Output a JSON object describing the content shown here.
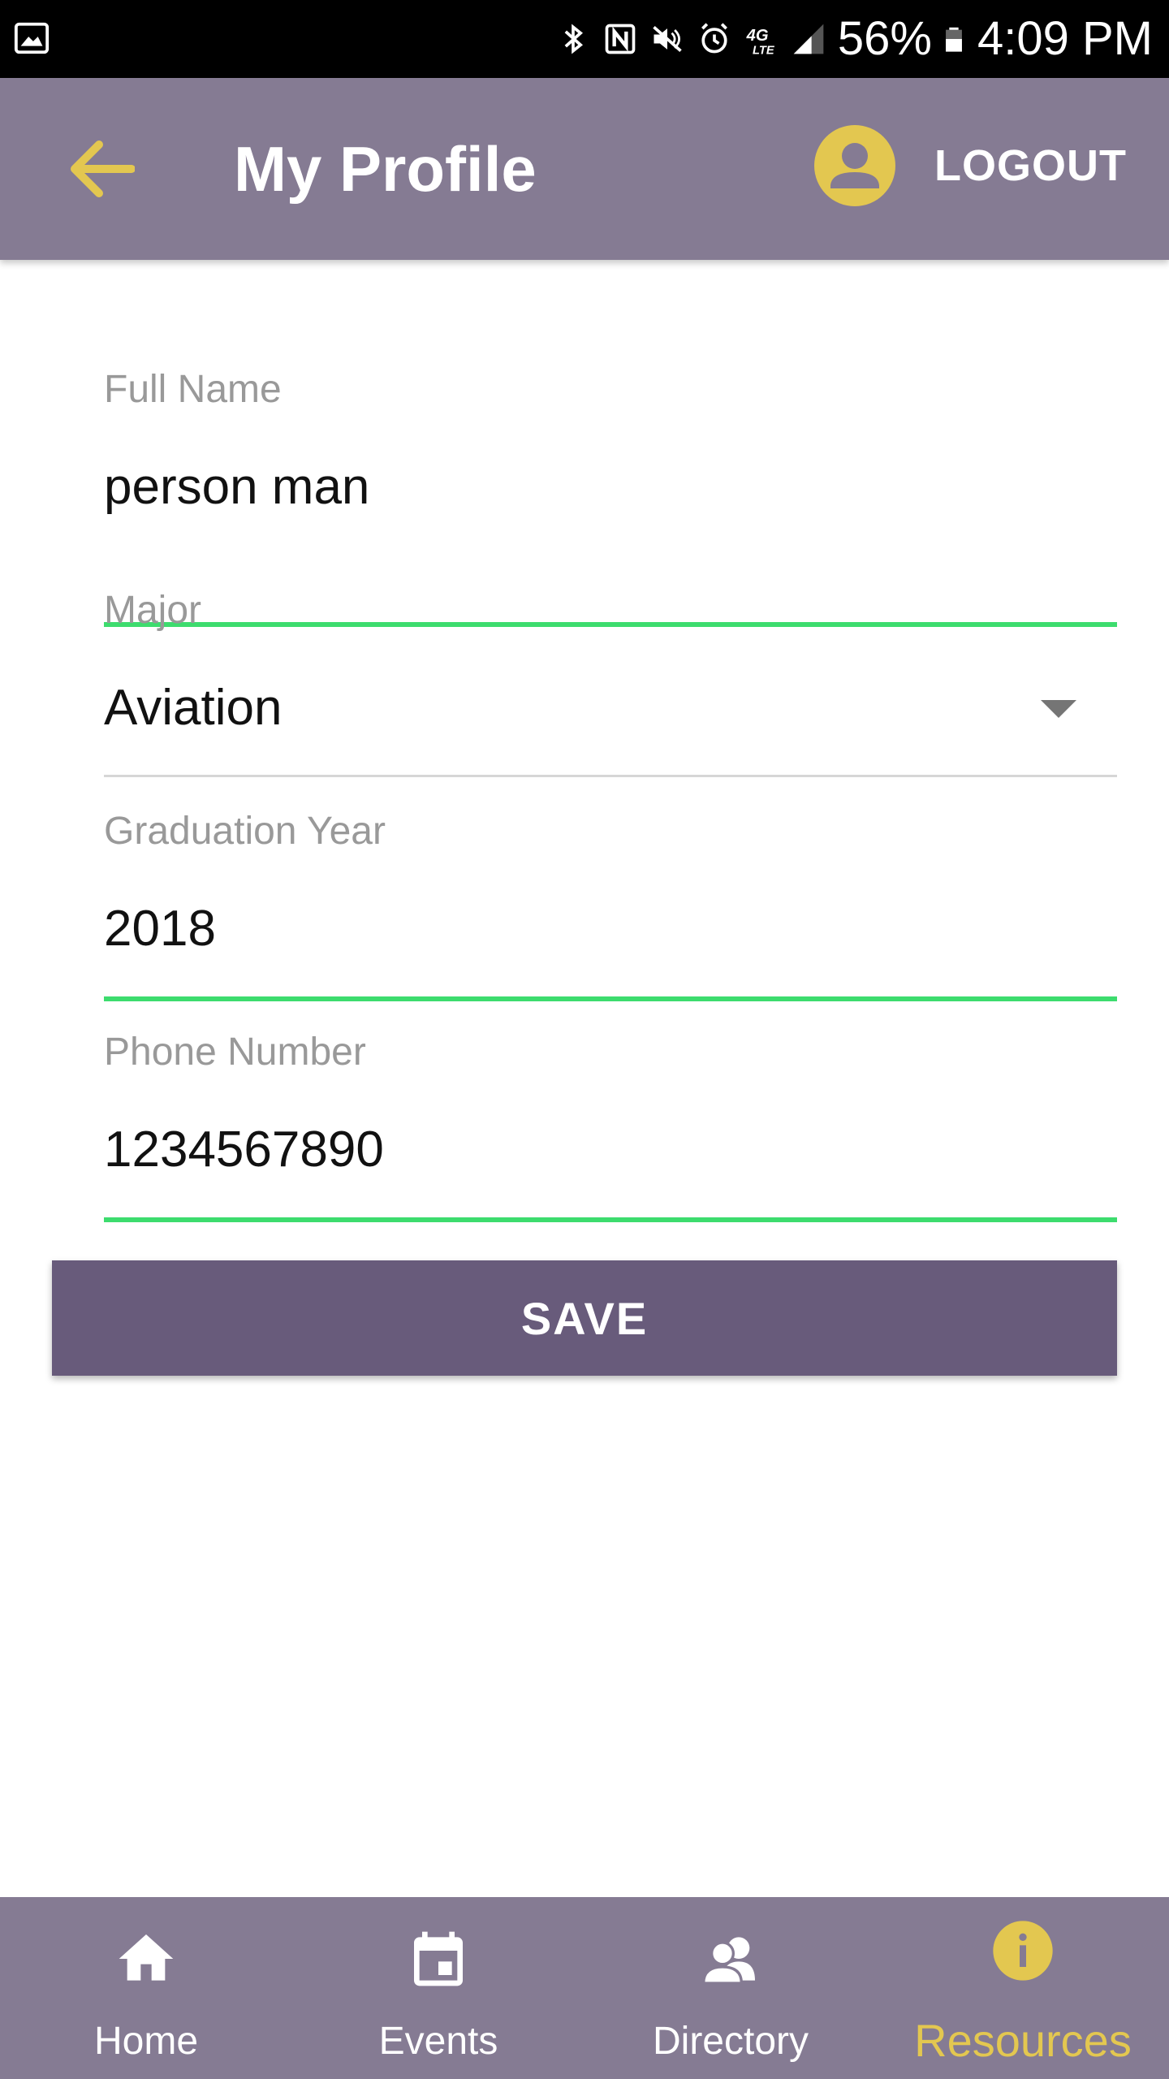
{
  "status_bar": {
    "battery": "56%",
    "time": "4:09 PM",
    "icons": [
      "gallery-icon",
      "bluetooth-icon",
      "nfc-icon",
      "mute-icon",
      "alarm-icon",
      "4g-lte-icon",
      "signal-icon",
      "battery-icon"
    ]
  },
  "header": {
    "title": "My Profile",
    "logout_label": "LOGOUT",
    "back_icon": "arrow-left-icon",
    "avatar_icon": "account-circle-icon",
    "background_color": "#857b93",
    "accent_color": "#e3c750"
  },
  "form": {
    "full_name": {
      "label": "Full Name",
      "value": "person man"
    },
    "major": {
      "label": "Major",
      "value": "Aviation"
    },
    "graduation_year": {
      "label": "Graduation Year",
      "value": "2018"
    },
    "phone_number": {
      "label": "Phone Number",
      "value": "1234567890"
    },
    "active_underline_color": "#3ddc6e"
  },
  "save_label": "SAVE",
  "save_color": "#685b7b",
  "bottom_nav": {
    "items": [
      {
        "label": "Home",
        "icon": "home-icon",
        "active": false
      },
      {
        "label": "Events",
        "icon": "calendar-icon",
        "active": false
      },
      {
        "label": "Directory",
        "icon": "people-icon",
        "active": false
      },
      {
        "label": "Resources",
        "icon": "info-icon",
        "active": true
      }
    ]
  }
}
